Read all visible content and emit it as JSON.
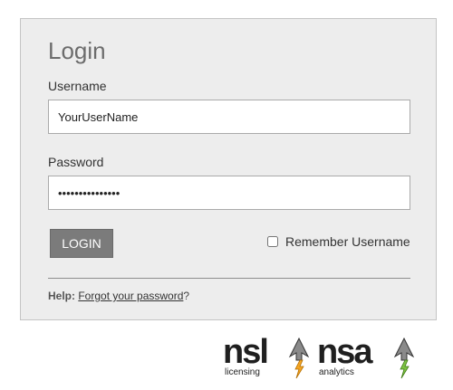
{
  "login": {
    "title": "Login",
    "username_label": "Username",
    "username_value": "YourUserName",
    "password_label": "Password",
    "password_value": "password1234567",
    "login_button": "LOGIN",
    "remember_label": "Remember Username",
    "remember_checked": false,
    "help_label": "Help:",
    "forgot_link": "Forgot your password",
    "help_suffix": "?"
  },
  "branding": {
    "nsl_word": "nsl",
    "nsl_sub": "licensing",
    "nsl_icon": "arrow-lightning-orange-icon",
    "nsa_word": "nsa",
    "nsa_sub": "analytics",
    "nsa_icon": "arrow-lightning-green-icon"
  },
  "colors": {
    "panel_bg": "#ededed",
    "button_bg": "#7b7b7b",
    "nsl_accent": "#f5a623",
    "nsa_accent": "#7cc242"
  }
}
